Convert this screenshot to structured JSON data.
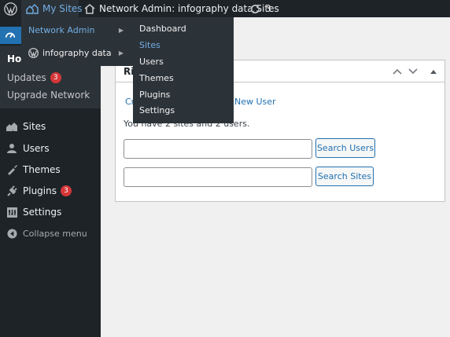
{
  "adminbar": {
    "my_sites": "My Sites",
    "network_admin": "Network Admin: infography data Sites",
    "updates_count": "3"
  },
  "sidebar": {
    "submenu": {
      "home": "Home",
      "updates": "Updates",
      "updates_badge": "3",
      "upgrade": "Upgrade Network"
    },
    "items": [
      {
        "label": "Sites",
        "icon": "sites-icon"
      },
      {
        "label": "Users",
        "icon": "users-icon"
      },
      {
        "label": "Themes",
        "icon": "themes-icon"
      },
      {
        "label": "Plugins",
        "icon": "plugins-icon",
        "badge": "3"
      },
      {
        "label": "Settings",
        "icon": "settings-icon"
      }
    ],
    "collapse": "Collapse menu"
  },
  "dropdown": {
    "network_admin": "Network Admin",
    "site": "infography data",
    "submenu": [
      "Dashboard",
      "Sites",
      "Users",
      "Themes",
      "Plugins",
      "Settings"
    ],
    "active": "Sites"
  },
  "widget": {
    "title_fragment": "Ri",
    "link_create_fragment": "Cr",
    "link_new_user": "New User",
    "count_text": "You have 2 sites and 2 users.",
    "search_users_button": "Search Users",
    "search_sites_button": "Search Sites"
  },
  "colors": {
    "adminbar_bg": "#1d2327",
    "accent": "#2271b1",
    "link_blue": "#72aee6",
    "badge": "#d63638"
  }
}
